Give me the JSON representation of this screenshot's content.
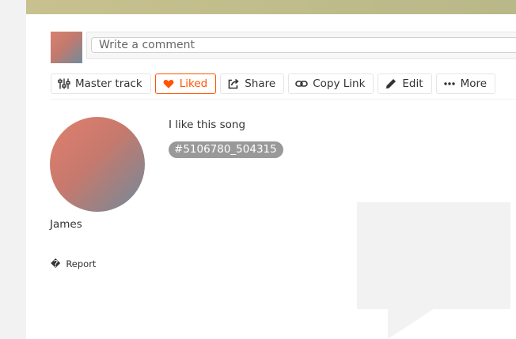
{
  "comment": {
    "placeholder": "Write a comment"
  },
  "actions": {
    "master_track": "Master track",
    "liked": "Liked",
    "share": "Share",
    "copy_link": "Copy Link",
    "edit": "Edit",
    "more": "More"
  },
  "colors": {
    "accent": "#ff5500",
    "tag_bg": "#999999",
    "header_band": "#c4bf8c"
  },
  "icons": {
    "master_track": "sliders-icon",
    "liked": "heart-icon",
    "share": "share-icon",
    "copy_link": "link-icon",
    "edit": "pencil-icon",
    "more": "ellipsis-icon",
    "report": "flag-icon"
  },
  "user": {
    "name": "James"
  },
  "track": {
    "description": "I like this song",
    "tag": "5106780_504315"
  },
  "report": {
    "icon_glyph": "�",
    "label": "Report"
  }
}
